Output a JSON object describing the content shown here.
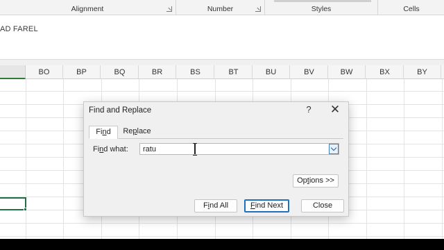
{
  "ribbon": {
    "groups": [
      {
        "label": "Alignment",
        "has_launcher": true
      },
      {
        "label": "Number",
        "has_launcher": true
      },
      {
        "label": "Styles",
        "has_launcher": false
      },
      {
        "label": "Cells",
        "has_launcher": false
      }
    ]
  },
  "formula_bar": {
    "text": "AD FAREL"
  },
  "sheet": {
    "columns": [
      "BO",
      "BP",
      "BQ",
      "BR",
      "BS",
      "BT",
      "BU",
      "BV",
      "BW",
      "BX",
      "BY"
    ]
  },
  "dialog": {
    "title": "Find and Replace",
    "help": "?",
    "close": "✕",
    "tabs": {
      "find_pre": "Fi",
      "find_ul": "n",
      "find_post": "d",
      "replace_pre": "Re",
      "replace_ul": "p",
      "replace_post": "lace"
    },
    "find_label_pre": "Fi",
    "find_label_ul": "n",
    "find_label_post": "d what:",
    "find_value": "ratu",
    "buttons": {
      "options_pre": "Op",
      "options_ul": "t",
      "options_post": "ions >>",
      "find_all_pre": "F",
      "find_all_ul": "i",
      "find_all_post": "nd All",
      "find_next_pre": "",
      "find_next_ul": "F",
      "find_next_post": "ind Next",
      "close": "Close"
    }
  }
}
